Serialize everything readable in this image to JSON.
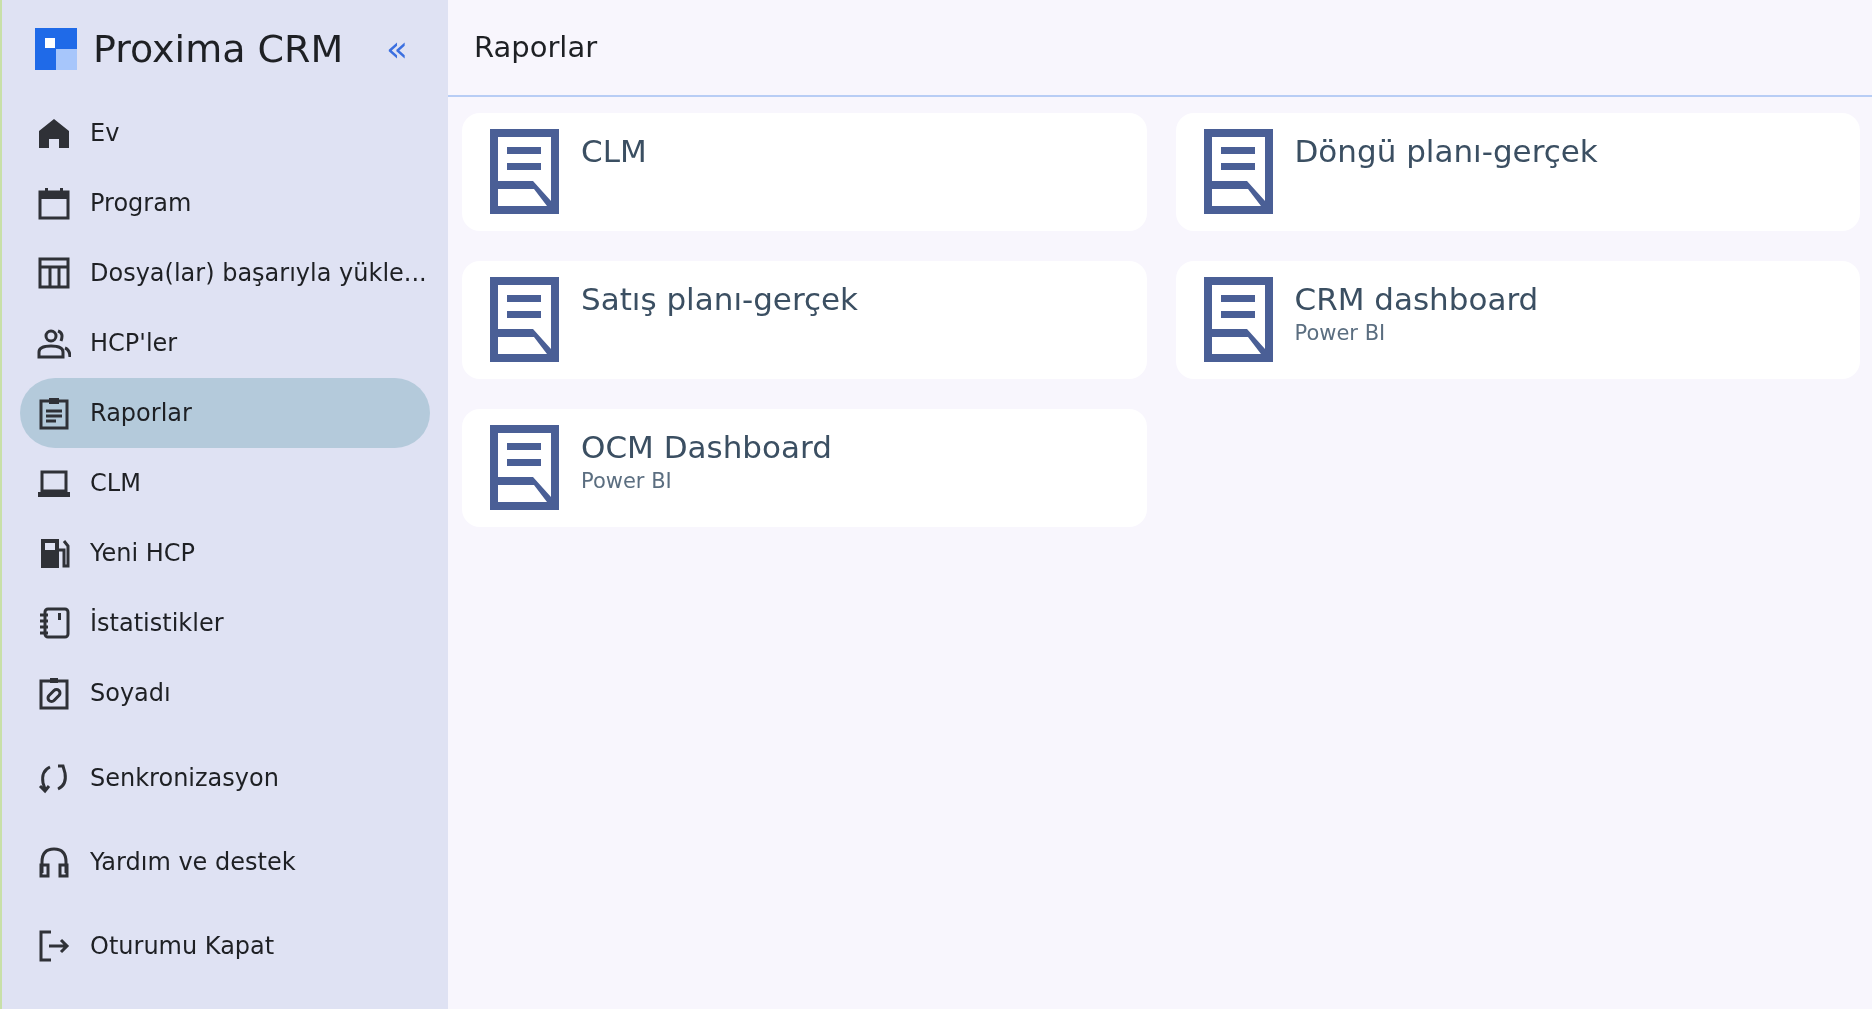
{
  "sidebar": {
    "app_title": "Proxima CRM",
    "collapse_label": "«",
    "items": [
      {
        "label": "Ev",
        "selected": false
      },
      {
        "label": "Program",
        "selected": false
      },
      {
        "label": "Dosya(lar) başarıyla yükle...",
        "selected": false
      },
      {
        "label": "HCP'ler",
        "selected": false
      },
      {
        "label": "Raporlar",
        "selected": true
      },
      {
        "label": "CLM",
        "selected": false
      },
      {
        "label": "Yeni HCP",
        "selected": false
      },
      {
        "label": "İstatistikler",
        "selected": false
      },
      {
        "label": "Soyadı",
        "selected": false
      }
    ],
    "actions": [
      {
        "label": "Senkronizasyon"
      },
      {
        "label": "Yardım ve destek"
      },
      {
        "label": "Oturumu Kapat"
      }
    ]
  },
  "header": {
    "title": "Raporlar"
  },
  "reports": [
    {
      "title": "CLM"
    },
    {
      "title": "Döngü planı-gerçek"
    },
    {
      "title": "Satış planı-gerçek"
    },
    {
      "title": "CRM dashboard",
      "subtitle": "Power BI"
    },
    {
      "title": "OCM Dashboard",
      "subtitle": "Power BI"
    }
  ]
}
